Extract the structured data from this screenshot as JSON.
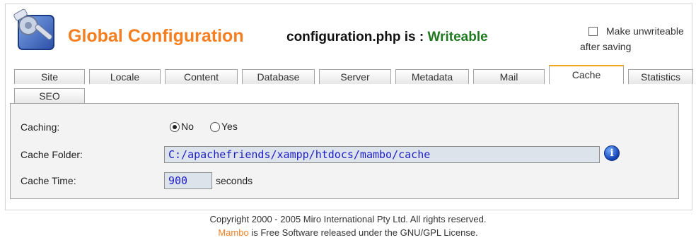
{
  "header": {
    "title": "Global Configuration",
    "status_prefix": "configuration.php is : ",
    "status_value": "Writeable",
    "unwriteable_line1": "Make unwriteable",
    "unwriteable_line2": "after saving",
    "unwriteable_checked": false
  },
  "tabs": [
    {
      "label": "Site"
    },
    {
      "label": "Locale"
    },
    {
      "label": "Content"
    },
    {
      "label": "Database"
    },
    {
      "label": "Server"
    },
    {
      "label": "Metadata"
    },
    {
      "label": "Mail"
    },
    {
      "label": "Cache",
      "active": true
    },
    {
      "label": "Statistics"
    },
    {
      "label": "SEO"
    }
  ],
  "cache": {
    "caching_label": "Caching:",
    "opt_no": "No",
    "opt_yes": "Yes",
    "selected": "No",
    "folder_label": "Cache Folder:",
    "folder_value": "C:/apachefriends/xampp/htdocs/mambo/cache",
    "info_icon": "i",
    "time_label": "Cache Time:",
    "time_value": "900",
    "time_unit": "seconds"
  },
  "footer": {
    "copyright": "Copyright 2000 - 2005 Miro International Pty Ltd. All rights reserved.",
    "brand": "Mambo",
    "license": " is Free Software released under the GNU/GPL License."
  },
  "colors": {
    "brand_orange": "#f57f20",
    "writeable_green": "#1f7a1f",
    "input_text_blue": "#1d1dc8"
  },
  "icons": {
    "logo": "config-tools-icon",
    "info": "info-icon"
  }
}
